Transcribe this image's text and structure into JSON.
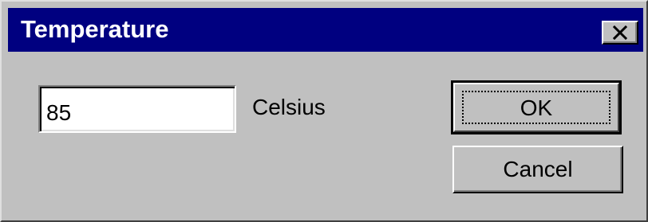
{
  "dialog": {
    "title": "Temperature",
    "close_icon": "close-icon"
  },
  "form": {
    "temperature_value": "85",
    "unit_label": "Celsius"
  },
  "buttons": {
    "ok_label": "OK",
    "cancel_label": "Cancel"
  },
  "colors": {
    "titlebar": "#000080",
    "face": "#c0c0c0",
    "title_text": "#ffffff"
  }
}
